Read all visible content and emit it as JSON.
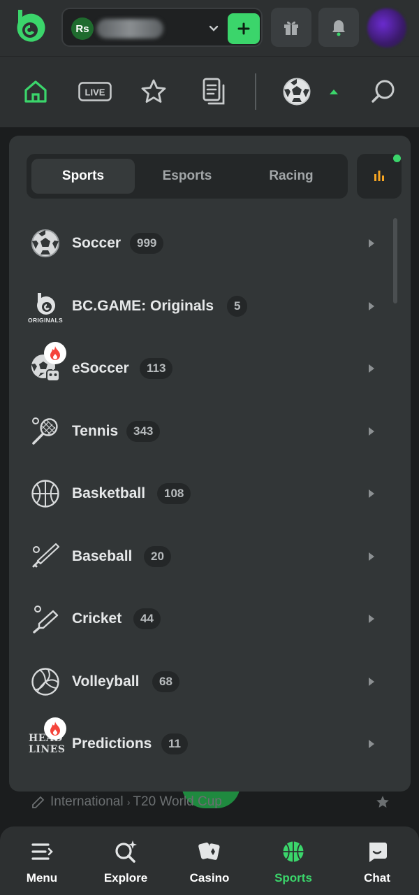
{
  "header": {
    "currency_symbol": "Rs",
    "balance": "",
    "icons": [
      "bc-logo-icon",
      "chevron-down-icon",
      "plus-icon",
      "gift-icon",
      "bell-icon",
      "avatar"
    ]
  },
  "nav": {
    "live_label": "LIVE",
    "icons": [
      "home-icon",
      "live-icon",
      "star-icon",
      "betslip-icon",
      "soccer-ball-icon",
      "caret-up-icon",
      "search-icon"
    ]
  },
  "tabs": [
    {
      "label": "Sports",
      "active": true
    },
    {
      "label": "Esports",
      "active": false
    },
    {
      "label": "Racing",
      "active": false
    }
  ],
  "sports": [
    {
      "name": "Soccer",
      "count": "999",
      "icon": "soccer-icon",
      "hot": false
    },
    {
      "name": "BC.GAME: Originals",
      "count": "5",
      "icon": "originals-icon",
      "icon_caption": "ORIGINALS",
      "hot": false
    },
    {
      "name": "eSoccer",
      "count": "113",
      "icon": "esoccer-icon",
      "hot": true
    },
    {
      "name": "Tennis",
      "count": "343",
      "icon": "tennis-icon",
      "hot": false
    },
    {
      "name": "Basketball",
      "count": "108",
      "icon": "basketball-icon",
      "hot": false
    },
    {
      "name": "Baseball",
      "count": "20",
      "icon": "baseball-icon",
      "hot": false
    },
    {
      "name": "Cricket",
      "count": "44",
      "icon": "cricket-icon",
      "hot": false
    },
    {
      "name": "Volleyball",
      "count": "68",
      "icon": "volleyball-icon",
      "hot": false
    },
    {
      "name": "Predictions",
      "count": "11",
      "icon": "headlines-icon",
      "icon_caption": "HEAD LINES",
      "hot": true
    }
  ],
  "behind": {
    "crumb_1": "International",
    "crumb_2": "T20 World Cup"
  },
  "bottom_nav": [
    {
      "label": "Menu",
      "icon": "menu-icon",
      "active": false
    },
    {
      "label": "Explore",
      "icon": "explore-icon",
      "active": false
    },
    {
      "label": "Casino",
      "icon": "cards-icon",
      "active": false
    },
    {
      "label": "Sports",
      "icon": "basketball-icon",
      "active": true
    },
    {
      "label": "Chat",
      "icon": "chat-icon",
      "active": false
    }
  ],
  "colors": {
    "accent": "#3bd56b",
    "panel": "#323637",
    "header": "#2d3031",
    "hot": "#f5433a"
  }
}
